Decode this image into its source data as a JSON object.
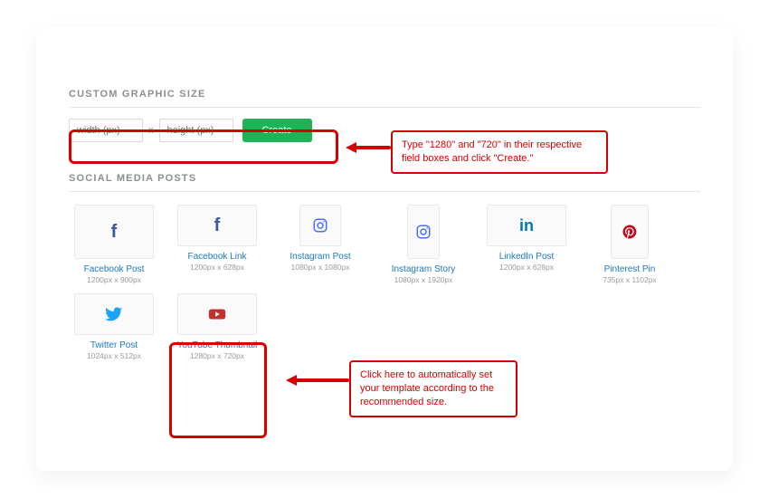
{
  "sections": {
    "custom_size_label": "CUSTOM GRAPHIC SIZE",
    "social_label": "SOCIAL MEDIA POSTS"
  },
  "size_form": {
    "width_placeholder": "width (px)",
    "height_placeholder": "height (px)",
    "sep": "x",
    "create_label": "Create"
  },
  "templates": [
    {
      "id": "facebook-post",
      "label": "Facebook Post",
      "dims": "1200px x 900px",
      "icon": "facebook",
      "box": "box-200x150"
    },
    {
      "id": "facebook-link",
      "label": "Facebook Link",
      "dims": "1200px x 628px",
      "icon": "facebook",
      "box": "box-200x100"
    },
    {
      "id": "instagram-post",
      "label": "Instagram Post",
      "dims": "1080px x 1080px",
      "icon": "instagram",
      "box": "box-sq"
    },
    {
      "id": "instagram-story",
      "label": "Instagram Story",
      "dims": "1080px x 1920px",
      "icon": "instagram",
      "box": "box-tall"
    },
    {
      "id": "linkedin-post",
      "label": "LinkedIn Post",
      "dims": "1200px x 628px",
      "icon": "linkedin",
      "box": "box-200x100"
    },
    {
      "id": "pinterest-pin",
      "label": "Pinterest Pin",
      "dims": "735px x 1102px",
      "icon": "pinterest",
      "box": "box-tall-wide"
    },
    {
      "id": "twitter-post",
      "label": "Twitter Post",
      "dims": "1024px x 512px",
      "icon": "twitter",
      "box": "box-200x100"
    },
    {
      "id": "youtube-thumb",
      "label": "YouTube Thumbnail",
      "dims": "1280px x 720px",
      "icon": "youtube",
      "box": "box-200x100"
    }
  ],
  "annotations": {
    "callout1": "Type \"1280\" and \"720\" in their respective field boxes and click \"Create.\"",
    "callout2": "Click here to automatically set your template according to the recommended size."
  }
}
